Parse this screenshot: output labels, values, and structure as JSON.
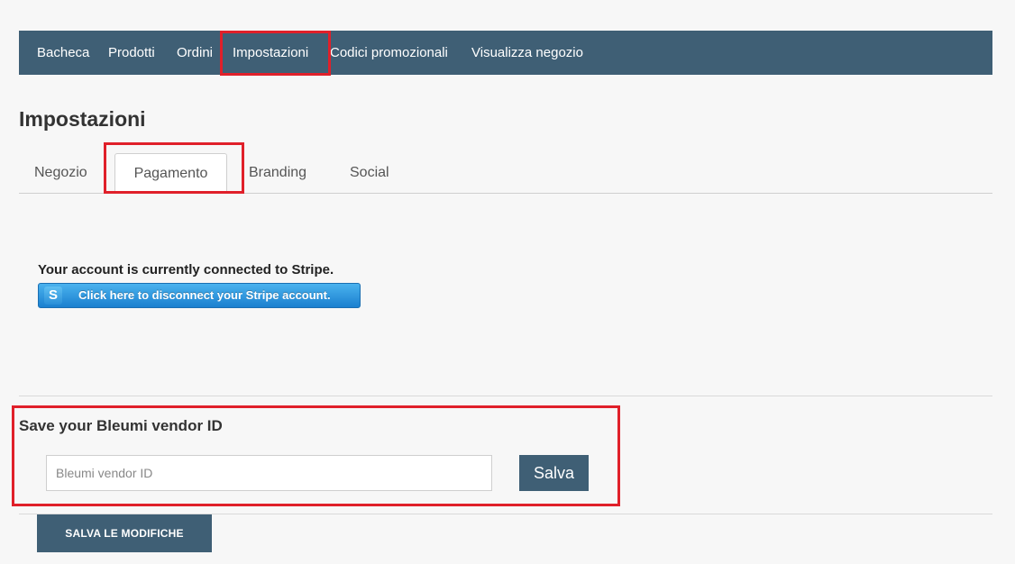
{
  "nav": {
    "items": [
      {
        "label": "Bacheca"
      },
      {
        "label": "Prodotti"
      },
      {
        "label": "Ordini"
      },
      {
        "label": "Impostazioni"
      },
      {
        "label": "Codici promozionali"
      },
      {
        "label": "Visualizza negozio"
      }
    ],
    "active_index": 3
  },
  "page": {
    "title": "Impostazioni"
  },
  "tabs": {
    "items": [
      {
        "label": "Negozio"
      },
      {
        "label": "Pagamento"
      },
      {
        "label": "Branding"
      },
      {
        "label": "Social"
      }
    ],
    "active_index": 1
  },
  "stripe": {
    "status_text": "Your account is currently connected to Stripe.",
    "button_icon_letter": "S",
    "button_label": "Click here to disconnect your Stripe account."
  },
  "vendor": {
    "heading": "Save your Bleumi vendor ID",
    "input_placeholder": "Bleumi vendor ID",
    "input_value": "",
    "save_label": "Salva"
  },
  "footer": {
    "save_all_label": "SALVA LE MODIFICHE"
  },
  "colors": {
    "nav_bg": "#3f5f75",
    "highlight": "#e0202a",
    "stripe_blue": "#1b80cf"
  }
}
